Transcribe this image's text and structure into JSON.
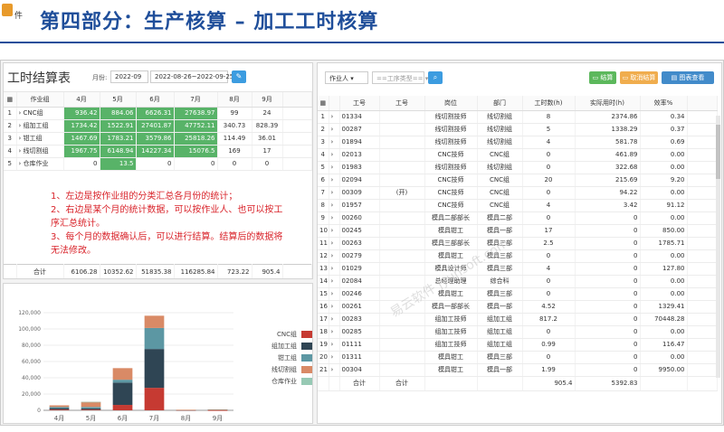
{
  "slide": {
    "title": "第四部分：生产核算 – 加工工时核算",
    "logo_text": "件"
  },
  "left": {
    "title": "工时结算表",
    "month_label": "月份:",
    "month_value": "2022-09",
    "range_value": "2022-08-26~2022-09-25",
    "headers": [
      "作业组",
      "4月",
      "5月",
      "6月",
      "7月",
      "8月",
      "9月"
    ],
    "rows": [
      {
        "idx": "1",
        "group": "CNC组",
        "vals": [
          "936.42",
          "884.06",
          "6626.31",
          "27638.97",
          "99",
          "24"
        ]
      },
      {
        "idx": "2",
        "group": "组加工组",
        "vals": [
          "1734.42",
          "1522.91",
          "27401.87",
          "47752.11",
          "340.73",
          "828.39"
        ]
      },
      {
        "idx": "3",
        "group": "钳工组",
        "vals": [
          "1467.69",
          "1783.21",
          "3579.86",
          "25818.26",
          "114.49",
          "36.01"
        ]
      },
      {
        "idx": "4",
        "group": "线切割组",
        "vals": [
          "1967.75",
          "6148.94",
          "14227.34",
          "15076.5",
          "169",
          "17"
        ]
      },
      {
        "idx": "5",
        "group": "仓库作业",
        "vals": [
          "0",
          "13.5",
          "0",
          "0",
          "0",
          "0"
        ]
      }
    ],
    "total_label": "合计",
    "totals": [
      "6106.28",
      "10352.62",
      "51835.38",
      "116285.84",
      "723.22",
      "905.4"
    ],
    "notes": [
      "1、左边是按作业组的分类汇总各月份的统计；",
      "2、右边是某个月的统计数据，可以按作业人、也可以按工序汇总统计。",
      "3、每个月的数据确认后，可以进行结算。结算后的数据将无法修改。"
    ]
  },
  "chart_data": {
    "type": "bar",
    "stacked": true,
    "categories": [
      "4月",
      "5月",
      "6月",
      "7月",
      "8月",
      "9月"
    ],
    "yticks": [
      "0",
      "20,000",
      "40,000",
      "60,000",
      "80,000",
      "100,000",
      "120,000"
    ],
    "ylim": [
      0,
      120000
    ],
    "legend_position": "right",
    "series": [
      {
        "name": "CNC组",
        "color": "#c63a32",
        "values": [
          936.42,
          884.06,
          6626.31,
          27638.97,
          99,
          24
        ]
      },
      {
        "name": "组加工组",
        "color": "#2f4554",
        "values": [
          1734.42,
          1522.91,
          27401.87,
          47752.11,
          340.73,
          828.39
        ]
      },
      {
        "name": "钳工组",
        "color": "#5c97a3",
        "values": [
          1467.69,
          1783.21,
          3579.86,
          25818.26,
          114.49,
          36.01
        ]
      },
      {
        "name": "线切割组",
        "color": "#d98a66",
        "values": [
          1967.75,
          6148.94,
          14227.34,
          15076.5,
          169,
          17
        ]
      },
      {
        "name": "仓库作业",
        "color": "#97c9b4",
        "values": [
          0,
          13.5,
          0,
          0,
          0,
          0
        ]
      }
    ]
  },
  "right": {
    "filter1": "作业人",
    "filter2_placeholder": "==工序类型==",
    "btn_settle": "结算",
    "btn_unsettle": "取消结算",
    "btn_chart": "图表查看",
    "headers": [
      "工号",
      "工号",
      "岗位",
      "部门",
      "工时数(h)",
      "实际用时(h)",
      "效率%"
    ],
    "rows": [
      [
        "1",
        "01334",
        "",
        "线切割技师",
        "线切割组",
        "8",
        "2374.86",
        "0.34"
      ],
      [
        "2",
        "00287",
        "",
        "线切割技师",
        "线切割组",
        "5",
        "1338.29",
        "0.37"
      ],
      [
        "3",
        "01894",
        "",
        "线切割技师",
        "线切割组",
        "4",
        "581.78",
        "0.69"
      ],
      [
        "4",
        "02013",
        "",
        "CNC技师",
        "CNC组",
        "0",
        "461.89",
        "0.00"
      ],
      [
        "5",
        "01983",
        "",
        "线切割技师",
        "线切割组",
        "0",
        "322.68",
        "0.00"
      ],
      [
        "6",
        "02094",
        "",
        "CNC技师",
        "CNC组",
        "20",
        "215.69",
        "9.20"
      ],
      [
        "7",
        "00309",
        "(开)",
        "CNC技师",
        "CNC组",
        "0",
        "94.22",
        "0.00"
      ],
      [
        "8",
        "01957",
        "",
        "CNC技师",
        "CNC组",
        "4",
        "3.42",
        "91.12"
      ],
      [
        "9",
        "00260",
        "",
        "模具二部部长",
        "模具二部",
        "0",
        "0",
        "0.00"
      ],
      [
        "10",
        "00245",
        "",
        "模具钳工",
        "模具一部",
        "17",
        "0",
        "850.00"
      ],
      [
        "11",
        "00263",
        "",
        "模具三部部长",
        "模具三部",
        "2.5",
        "0",
        "1785.71"
      ],
      [
        "12",
        "00279",
        "",
        "模具钳工",
        "模具三部",
        "0",
        "0",
        "0.00"
      ],
      [
        "13",
        "01029",
        "",
        "模具设计师",
        "模具三部",
        "4",
        "0",
        "127.80"
      ],
      [
        "14",
        "02084",
        "",
        "总经理助理",
        "综合科",
        "0",
        "0",
        "0.00"
      ],
      [
        "15",
        "00246",
        "",
        "模具钳工",
        "模具三部",
        "0",
        "0",
        "0.00"
      ],
      [
        "16",
        "00261",
        "",
        "模具一部部长",
        "模具一部",
        "4.52",
        "0",
        "1329.41"
      ],
      [
        "17",
        "00283",
        "",
        "组加工技师",
        "组加工组",
        "817.2",
        "0",
        "70448.28"
      ],
      [
        "18",
        "00285",
        "",
        "组加工技师",
        "组加工组",
        "0",
        "0",
        "0.00"
      ],
      [
        "19",
        "01111",
        "",
        "组加工技师",
        "组加工组",
        "0.99",
        "0",
        "116.47"
      ],
      [
        "20",
        "01311",
        "",
        "模具钳工",
        "模具三部",
        "0",
        "0",
        "0.00"
      ],
      [
        "21",
        "00304",
        "",
        "模具钳工",
        "模具一部",
        "1.99",
        "0",
        "9950.00"
      ]
    ],
    "total_label1": "合计",
    "total_label2": "合计",
    "total_hours": "905.4",
    "total_actual": "5392.83"
  },
  "watermark": "易云软件 jyunsoft.com"
}
